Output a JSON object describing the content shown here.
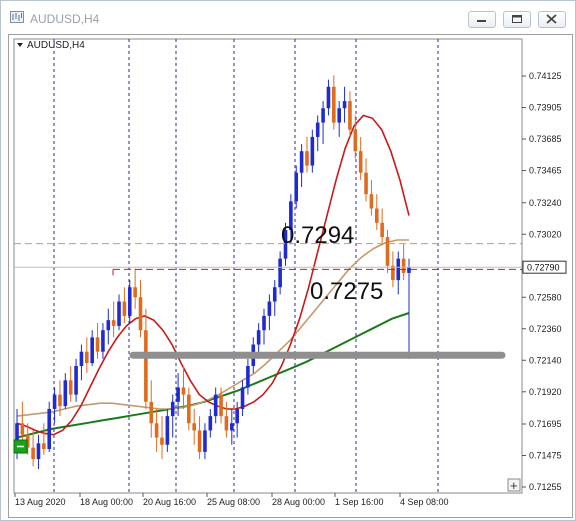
{
  "window": {
    "title": "AUDUSD,H4"
  },
  "chart_label": "AUDUSD,H4",
  "chart_data": {
    "type": "candlestick",
    "symbol": "AUDUSD",
    "timeframe": "H4",
    "ylim": [
      0.71255,
      0.7423
    ],
    "y_ticks": [
      "0.74125",
      "0.73905",
      "0.73685",
      "0.73465",
      "0.73240",
      "0.73020",
      "0.72580",
      "0.72360",
      "0.72140",
      "0.71920",
      "0.71695",
      "0.71475",
      "0.71255"
    ],
    "current_price_label": "0.72790",
    "x_ticks": [
      "13 Aug 2020",
      "18 Aug 00:00",
      "20 Aug 16:00",
      "25 Aug 08:00",
      "28 Aug 00:00",
      "1 Sep 16:00",
      "4 Sep 08:00"
    ],
    "annotations": [
      {
        "text": "0.7294",
        "price": 0.72955
      },
      {
        "text": "0.7275",
        "price": 0.7275
      }
    ],
    "levels": {
      "bid_line": 0.7279,
      "orange_dashed": 0.72955,
      "red_dashed": 0.72775,
      "grey_line": 0.72175,
      "support_zone": 0.72175
    },
    "candles": [
      [
        0.7158,
        0.718,
        0.7145,
        0.717
      ],
      [
        0.717,
        0.7185,
        0.7155,
        0.7162
      ],
      [
        0.7162,
        0.717,
        0.7148,
        0.7153
      ],
      [
        0.7153,
        0.7165,
        0.714,
        0.7145
      ],
      [
        0.7145,
        0.7162,
        0.7138,
        0.7156
      ],
      [
        0.7156,
        0.717,
        0.7148,
        0.7152
      ],
      [
        0.7152,
        0.7185,
        0.715,
        0.718
      ],
      [
        0.718,
        0.7195,
        0.717,
        0.719
      ],
      [
        0.719,
        0.72,
        0.7175,
        0.7182
      ],
      [
        0.7182,
        0.7205,
        0.718,
        0.72
      ],
      [
        0.72,
        0.721,
        0.7185,
        0.719
      ],
      [
        0.719,
        0.7215,
        0.7185,
        0.721
      ],
      [
        0.721,
        0.7225,
        0.72,
        0.722
      ],
      [
        0.722,
        0.723,
        0.7205,
        0.7212
      ],
      [
        0.7212,
        0.7235,
        0.721,
        0.723
      ],
      [
        0.723,
        0.724,
        0.7215,
        0.722
      ],
      [
        0.722,
        0.724,
        0.7215,
        0.7235
      ],
      [
        0.7235,
        0.725,
        0.7225,
        0.7242
      ],
      [
        0.7242,
        0.7255,
        0.723,
        0.7238
      ],
      [
        0.7238,
        0.726,
        0.7235,
        0.7255
      ],
      [
        0.7255,
        0.7265,
        0.724,
        0.7245
      ],
      [
        0.7245,
        0.727,
        0.724,
        0.7265
      ],
      [
        0.7265,
        0.7278,
        0.725,
        0.7258
      ],
      [
        0.7258,
        0.727,
        0.723,
        0.7235
      ],
      [
        0.7235,
        0.725,
        0.718,
        0.7185
      ],
      [
        0.7185,
        0.72,
        0.716,
        0.717
      ],
      [
        0.717,
        0.718,
        0.715,
        0.716
      ],
      [
        0.716,
        0.7175,
        0.7145,
        0.7155
      ],
      [
        0.7155,
        0.718,
        0.715,
        0.7175
      ],
      [
        0.7175,
        0.719,
        0.716,
        0.7185
      ],
      [
        0.7185,
        0.7205,
        0.7175,
        0.7195
      ],
      [
        0.7195,
        0.721,
        0.718,
        0.719
      ],
      [
        0.719,
        0.7195,
        0.7165,
        0.717
      ],
      [
        0.717,
        0.718,
        0.7155,
        0.7165
      ],
      [
        0.7165,
        0.7175,
        0.7145,
        0.715
      ],
      [
        0.715,
        0.717,
        0.7145,
        0.7165
      ],
      [
        0.7165,
        0.718,
        0.716,
        0.7175
      ],
      [
        0.7175,
        0.7195,
        0.717,
        0.719
      ],
      [
        0.719,
        0.7195,
        0.717,
        0.7175
      ],
      [
        0.7175,
        0.7185,
        0.716,
        0.7165
      ],
      [
        0.7165,
        0.718,
        0.7155,
        0.717
      ],
      [
        0.717,
        0.7185,
        0.716,
        0.718
      ],
      [
        0.718,
        0.72,
        0.7175,
        0.7195
      ],
      [
        0.7195,
        0.7215,
        0.719,
        0.721
      ],
      [
        0.721,
        0.723,
        0.7205,
        0.7225
      ],
      [
        0.7225,
        0.724,
        0.7215,
        0.7235
      ],
      [
        0.7235,
        0.725,
        0.7225,
        0.7245
      ],
      [
        0.7245,
        0.726,
        0.7235,
        0.7255
      ],
      [
        0.7255,
        0.727,
        0.7245,
        0.7265
      ],
      [
        0.7265,
        0.729,
        0.726,
        0.7285
      ],
      [
        0.7285,
        0.731,
        0.728,
        0.7305
      ],
      [
        0.7305,
        0.733,
        0.7295,
        0.7325
      ],
      [
        0.7325,
        0.735,
        0.732,
        0.7345
      ],
      [
        0.7345,
        0.7365,
        0.7335,
        0.736
      ],
      [
        0.736,
        0.737,
        0.7345,
        0.735
      ],
      [
        0.735,
        0.7375,
        0.7345,
        0.737
      ],
      [
        0.737,
        0.7385,
        0.736,
        0.738
      ],
      [
        0.738,
        0.7395,
        0.7365,
        0.739
      ],
      [
        0.739,
        0.741,
        0.7385,
        0.7405
      ],
      [
        0.7405,
        0.7413,
        0.7375,
        0.738
      ],
      [
        0.738,
        0.7395,
        0.737,
        0.739
      ],
      [
        0.739,
        0.7405,
        0.738,
        0.7395
      ],
      [
        0.7395,
        0.7402,
        0.737,
        0.7375
      ],
      [
        0.7375,
        0.7385,
        0.7355,
        0.736
      ],
      [
        0.736,
        0.737,
        0.734,
        0.7345
      ],
      [
        0.7345,
        0.7355,
        0.7325,
        0.733
      ],
      [
        0.733,
        0.734,
        0.7315,
        0.732
      ],
      [
        0.732,
        0.733,
        0.7305,
        0.731
      ],
      [
        0.731,
        0.732,
        0.7295,
        0.73
      ],
      [
        0.73,
        0.7305,
        0.7275,
        0.728
      ],
      [
        0.728,
        0.729,
        0.7265,
        0.727
      ],
      [
        0.727,
        0.729,
        0.726,
        0.7285
      ],
      [
        0.7285,
        0.7295,
        0.727,
        0.7275
      ],
      [
        0.7275,
        0.7285,
        0.7215,
        0.7279
      ]
    ],
    "ma_fast": [
      0.717,
      0.7168,
      0.7165,
      0.7163,
      0.7162,
      0.7165,
      0.7172,
      0.7182,
      0.7195,
      0.7208,
      0.722,
      0.723,
      0.7238,
      0.7243,
      0.7245,
      0.7242,
      0.7235,
      0.7225,
      0.7212,
      0.72,
      0.719,
      0.7185,
      0.7182,
      0.718,
      0.718,
      0.7182,
      0.7185,
      0.719,
      0.7198,
      0.721,
      0.7225,
      0.7243,
      0.7265,
      0.729,
      0.7315,
      0.734,
      0.7362,
      0.7378,
      0.7385,
      0.7383,
      0.7375,
      0.736,
      0.734,
      0.7315
    ],
    "ma_mid": [
      0.7175,
      0.7176,
      0.7177,
      0.7178,
      0.718,
      0.7182,
      0.7183,
      0.7184,
      0.7184,
      0.7183,
      0.7182,
      0.7181,
      0.718,
      0.718,
      0.7181,
      0.7183,
      0.7186,
      0.719,
      0.7195,
      0.72,
      0.7205,
      0.7212,
      0.722,
      0.7228,
      0.7238,
      0.7248,
      0.7258,
      0.7268,
      0.7278,
      0.7286,
      0.7292,
      0.7296,
      0.7298,
      0.7298
    ],
    "ma_slow": [
      0.716,
      0.7163,
      0.7166,
      0.7168,
      0.717,
      0.7172,
      0.7174,
      0.7176,
      0.7178,
      0.718,
      0.7182,
      0.7185,
      0.7189,
      0.7193,
      0.7198,
      0.7203,
      0.7208,
      0.7213,
      0.7219,
      0.7225,
      0.7231,
      0.7237,
      0.7243,
      0.7247
    ]
  }
}
